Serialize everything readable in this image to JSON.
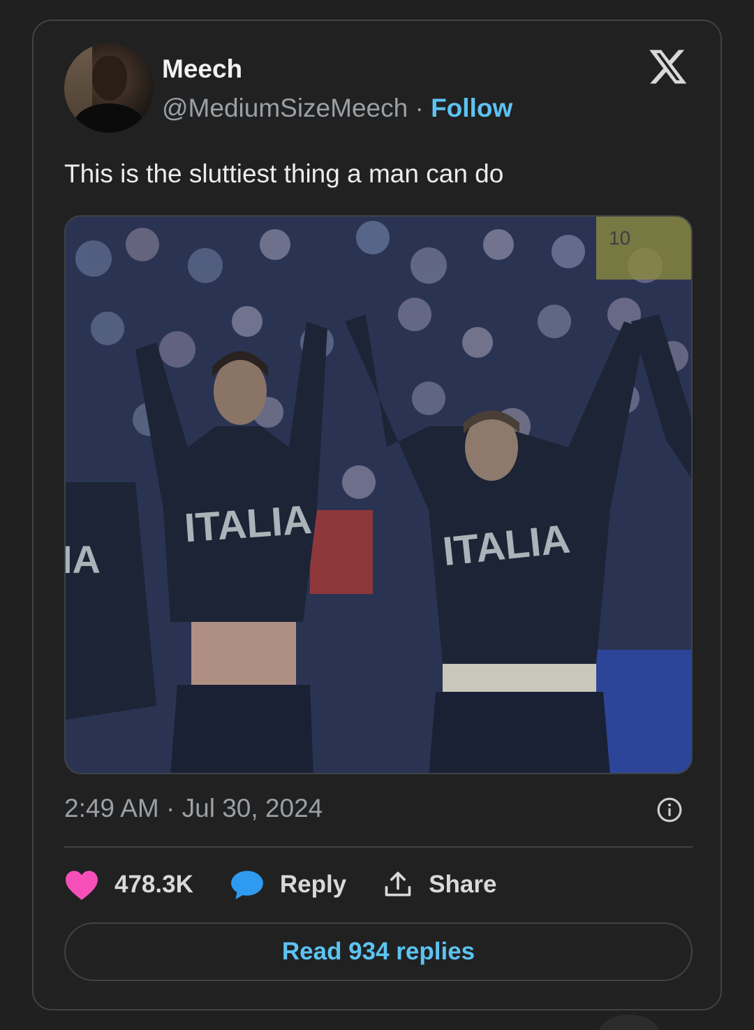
{
  "author": {
    "name": "Meech",
    "handle": "@MediumSizeMeech",
    "separator": "·",
    "follow_label": "Follow"
  },
  "tweet": {
    "text": "This is the sluttiest thing a man can do",
    "media_caption_left": "ITALIA",
    "media_caption_right": "ITALIA",
    "media_caption_edge": "IA",
    "jersey_number": "10",
    "timestamp": "2:49 AM · Jul 30, 2024"
  },
  "actions": {
    "likes": "478.3K",
    "reply_label": "Reply",
    "share_label": "Share"
  },
  "read_replies_label": "Read 934 replies",
  "icons": {
    "logo": "x-logo-icon",
    "info": "info-icon",
    "like": "heart-icon",
    "reply": "chat-bubble-icon",
    "share": "share-upload-icon"
  },
  "colors": {
    "background": "#202020",
    "accent": "#5cc3f2",
    "heart": "#f74fba",
    "text_muted": "#9aa0a6"
  }
}
